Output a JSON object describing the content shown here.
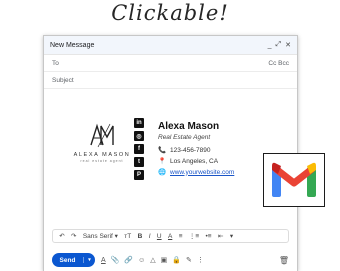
{
  "headline": "Clickable!",
  "window": {
    "title": "New Message",
    "controls": [
      "_",
      "⤢",
      "✕"
    ]
  },
  "fields": {
    "to_label": "To",
    "cc_bcc": "Cc Bcc",
    "subject_label": "Subject"
  },
  "logo": {
    "monogram": "AM",
    "name": "ALEXA MASON",
    "tagline": "real estate agent"
  },
  "socials": [
    {
      "icon": "linkedin-icon",
      "glyph": "in"
    },
    {
      "icon": "instagram-icon",
      "glyph": "◎"
    },
    {
      "icon": "facebook-icon",
      "glyph": "f"
    },
    {
      "icon": "twitter-icon",
      "glyph": "t"
    },
    {
      "icon": "pinterest-icon",
      "glyph": "P"
    }
  ],
  "signature": {
    "name": "Alexa Mason",
    "role": "Real Estate Agent",
    "phone": "123-456-7890",
    "location": "Los Angeles, CA",
    "website": "www.yourwebsite.com"
  },
  "formatting": {
    "undo": "↶",
    "redo": "↷",
    "font": "Sans Serif",
    "font_caret": "▾",
    "size": "тT",
    "bold": "B",
    "italic": "I",
    "underline": "U",
    "text_color": "A",
    "align": "≡",
    "numbered_list": "⋮≡",
    "bullet_list": "•≡",
    "indent": "⇤",
    "more": "▾"
  },
  "bottom": {
    "send_label": "Send",
    "send_caret": "▾",
    "tools": [
      "A",
      "📎",
      "🔗",
      "☺",
      "△",
      "▣",
      "🔒",
      "✎",
      "⋮"
    ],
    "trash": "🗑"
  },
  "colors": {
    "send_blue": "#0b57d0",
    "link_blue": "#1a55c7",
    "gmail_red": "#ea4335",
    "gmail_blue": "#4285f4",
    "gmail_green": "#34a853",
    "gmail_yellow": "#fbbc04"
  }
}
